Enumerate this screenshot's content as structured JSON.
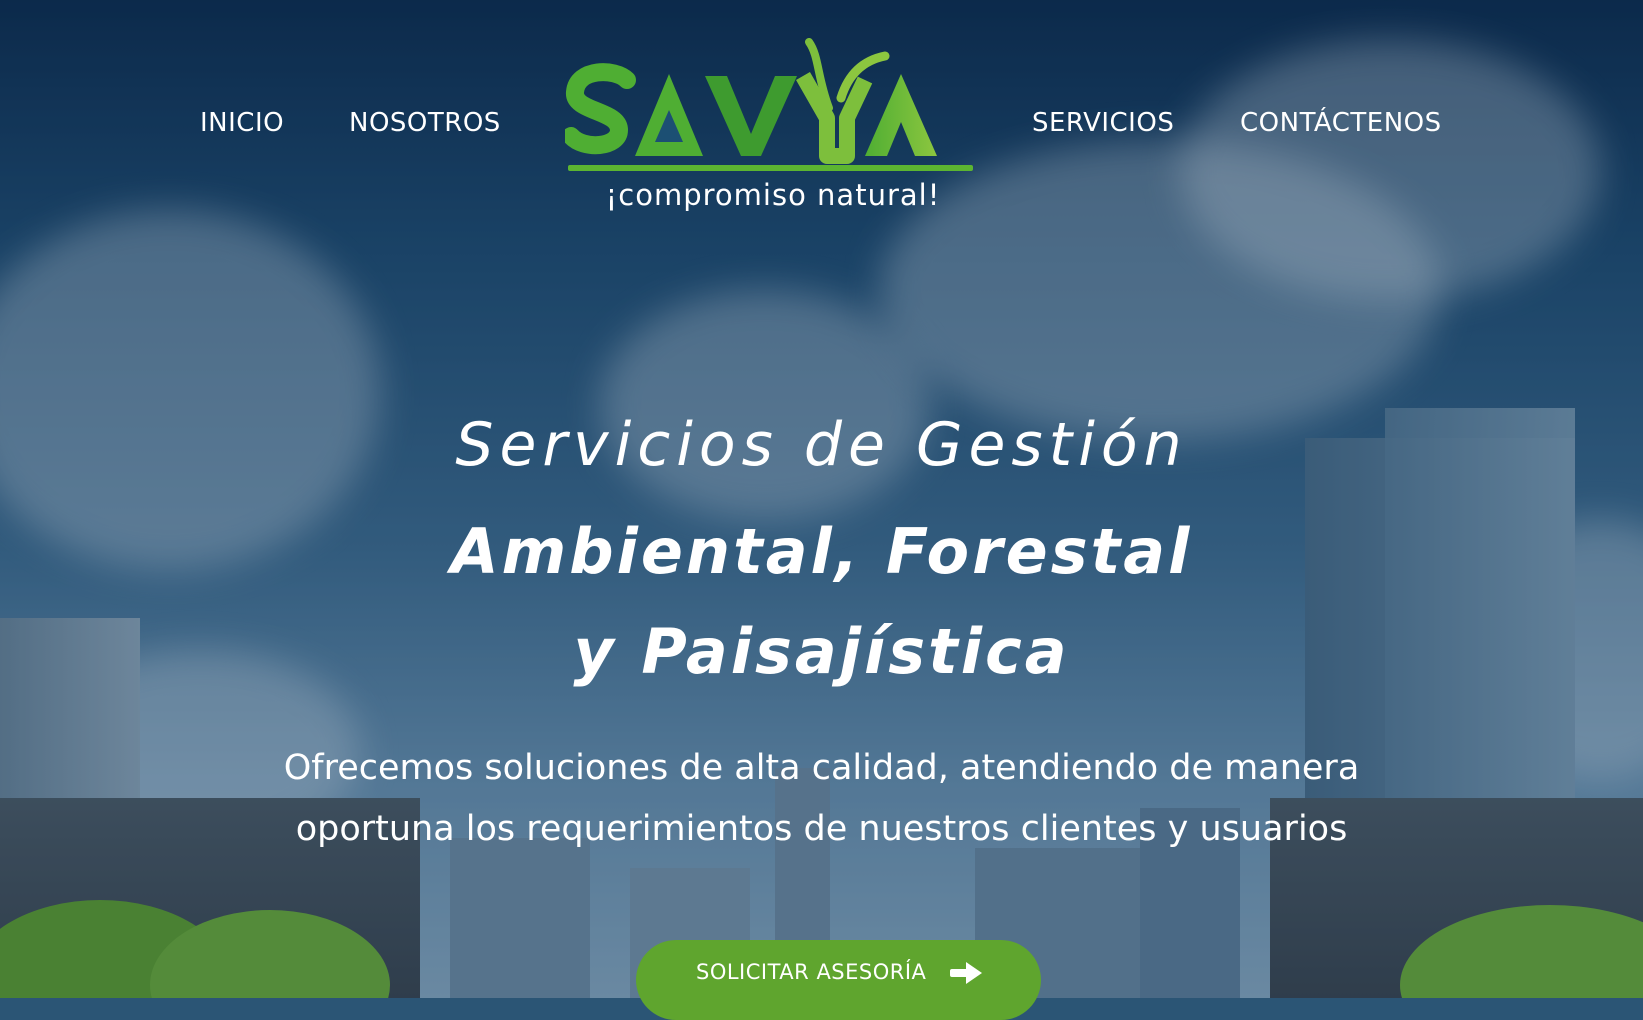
{
  "nav": {
    "left": [
      {
        "label": "INICIO"
      },
      {
        "label": "NOSOTROS"
      }
    ],
    "right": [
      {
        "label": "SERVICIOS"
      },
      {
        "label": "CONTÁCTENOS"
      }
    ]
  },
  "logo": {
    "wordmark": "SAVYA",
    "tagline": "¡compromiso natural!"
  },
  "hero": {
    "line1": "Servicios de Gestión",
    "line2": "Ambiental, Forestal",
    "line3": "y Paisajística",
    "subtitle_line1": "Ofrecemos soluciones de alta calidad, atendiendo de manera",
    "subtitle_line2": "oportuna los requerimientos de nuestros clientes y usuarios"
  },
  "cta": {
    "label": "SOLICITAR ASESORÍA",
    "icon": "arrow-right-icon"
  },
  "colors": {
    "brand_green": "#5fa52e",
    "logo_green_light": "#8cc63f",
    "logo_green_dark": "#3e9b2f",
    "sky_top": "#0c2c4f"
  }
}
